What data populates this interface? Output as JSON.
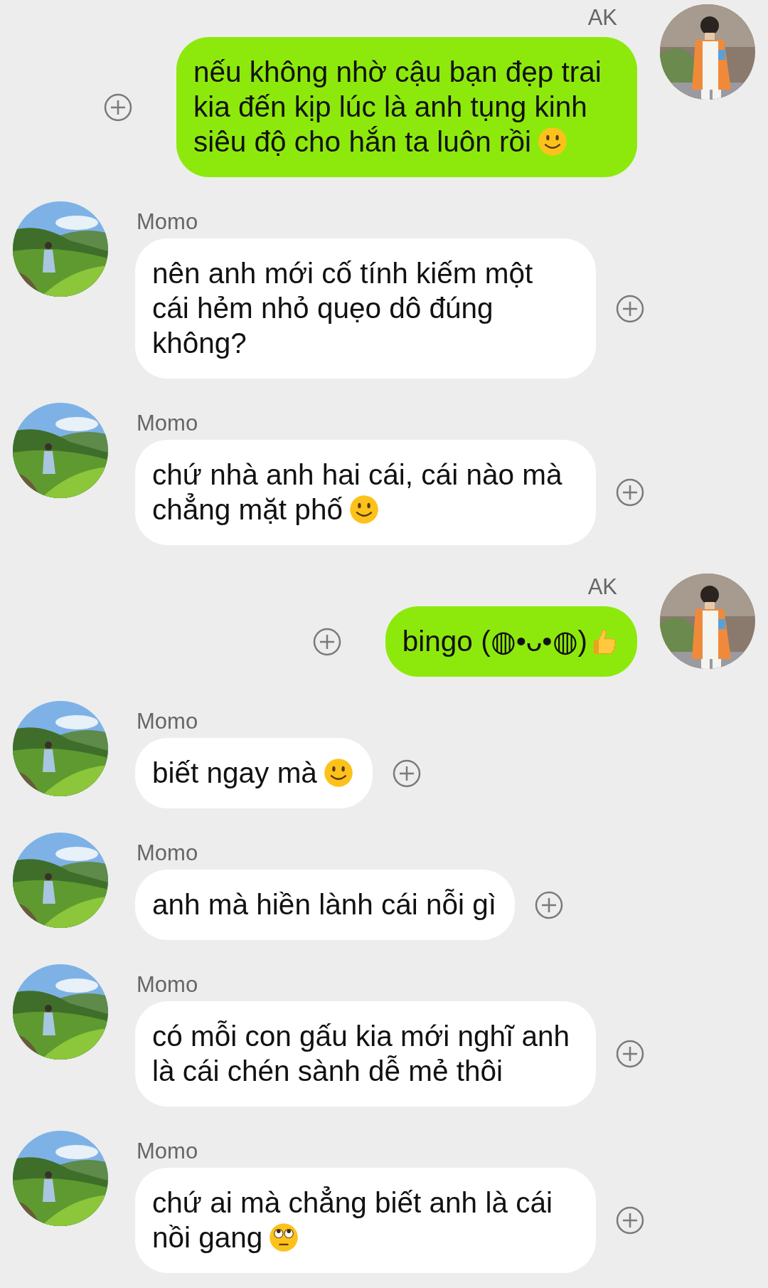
{
  "messages": [
    {
      "kind": "outgoing",
      "sender": "AK",
      "text": "nếu không nhờ cậu bạn đẹp trai kia đến kịp lúc là anh tụng kinh siêu độ cho hắn ta luôn rồi",
      "emoji": {
        "kind": "smile"
      }
    },
    {
      "kind": "incoming",
      "sender": "Momo",
      "text": "nên anh mới cố tính kiếm một cái hẻm nhỏ quẹo dô đúng không?"
    },
    {
      "kind": "incoming",
      "sender": "Momo",
      "text": "chứ nhà anh hai cái, cái nào mà chẳng mặt phố",
      "emoji": {
        "kind": "smile"
      }
    },
    {
      "kind": "outgoing",
      "sender": "AK",
      "text": "bingo (◍•ᴗ•◍)",
      "emoji": {
        "kind": "thumbs-up"
      }
    },
    {
      "kind": "incoming",
      "sender": "Momo",
      "text": "biết ngay mà",
      "emoji": {
        "kind": "smile"
      }
    },
    {
      "kind": "incoming",
      "sender": "Momo",
      "text": "anh mà hiền lành cái nỗi gì"
    },
    {
      "kind": "incoming",
      "sender": "Momo",
      "text": "có mỗi con gấu kia mới nghĩ anh là cái chén sành dễ mẻ thôi"
    },
    {
      "kind": "incoming",
      "sender": "Momo",
      "text": "chứ ai mà chẳng biết anh là cái nồi gang",
      "emoji": {
        "kind": "eye-roll"
      }
    }
  ]
}
